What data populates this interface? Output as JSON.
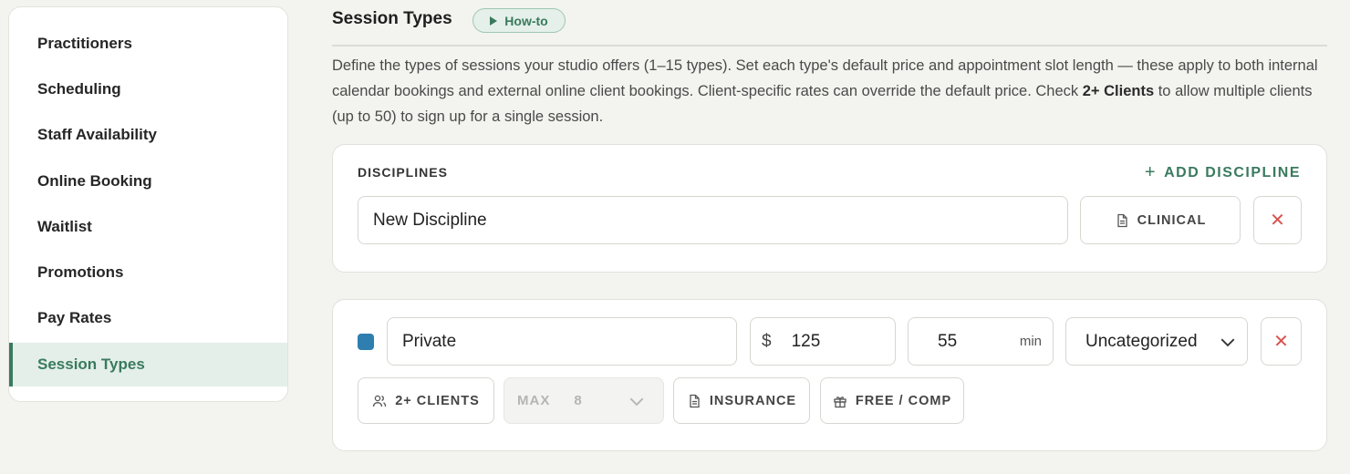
{
  "sidebar": {
    "items": [
      {
        "label": "Practitioners"
      },
      {
        "label": "Scheduling"
      },
      {
        "label": "Staff Availability"
      },
      {
        "label": "Online Booking"
      },
      {
        "label": "Waitlist"
      },
      {
        "label": "Promotions"
      },
      {
        "label": "Pay Rates"
      },
      {
        "label": "Session Types",
        "active": true
      }
    ]
  },
  "header": {
    "title": "Session Types",
    "howto_label": "How-to"
  },
  "description": {
    "part1": "Define the types of sessions your studio offers (1–15 types). Set each type's default price and appointment slot length — these apply to both internal calendar bookings and external online client bookings. Client-specific rates can override the default price. Check ",
    "bold": "2+ Clients",
    "part2": " to allow multiple clients (up to 50) to sign up for a single session."
  },
  "disciplines": {
    "section_label": "DISCIPLINES",
    "add_label": "ADD DISCIPLINE",
    "name_value": "New Discipline",
    "clinical_label": "CLINICAL",
    "remove_glyph": "✕"
  },
  "session_type": {
    "color": "#2e7eb0",
    "name_value": "Private",
    "currency_symbol": "$",
    "price_value": "125",
    "duration_value": "55",
    "duration_unit": "min",
    "category_value": "Uncategorized",
    "remove_glyph": "✕",
    "multi_clients_label": "2+ CLIENTS",
    "max_label": "MAX",
    "max_value": "8",
    "insurance_label": "INSURANCE",
    "free_comp_label": "FREE / COMP"
  },
  "colors": {
    "accent": "#3a7a5e",
    "danger": "#d9534f",
    "background": "#f3f3ef"
  }
}
